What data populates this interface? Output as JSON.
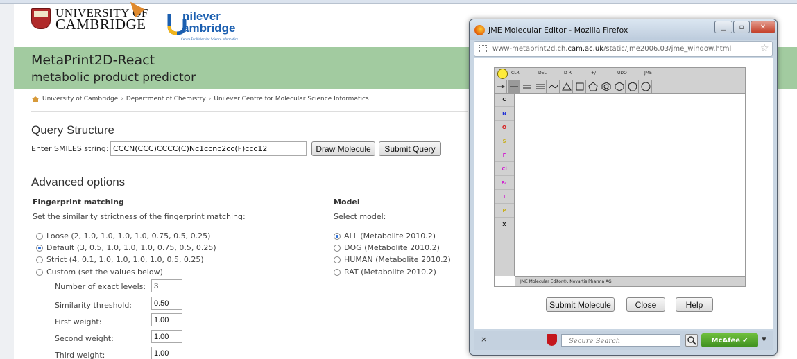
{
  "header": {
    "cambridge_line1": "UNIVERSITY OF",
    "cambridge_line2": "CAMBRIDGE",
    "unilever_line1": "nilever",
    "unilever_line2": "ambridge",
    "unilever_sub": "Centre For Molecular Science Informatics"
  },
  "banner": {
    "title": "MetaPrint2D-React",
    "subtitle": "metabolic product predictor"
  },
  "breadcrumb": [
    "University of Cambridge",
    "Department of Chemistry",
    "Unilever Centre for Molecular Science Informatics"
  ],
  "breadcrumb_sep": "›",
  "query": {
    "heading": "Query Structure",
    "smiles_label": "Enter SMILES string:",
    "smiles_value": "CCCN(CCC)CCCC(C)Nc1ccnc2cc(F)ccc12",
    "draw_button": "Draw Molecule",
    "submit_button": "Submit Query"
  },
  "advanced": {
    "heading": "Advanced options",
    "fingerprint": {
      "heading": "Fingerprint matching",
      "description": "Set the similarity strictness of the fingerprint matching:",
      "options": [
        {
          "label": "Loose (2, 1.0, 1.0, 1.0, 1.0, 0.75, 0.5, 0.25)",
          "checked": false
        },
        {
          "label": "Default (3, 0.5, 1.0, 1.0, 1.0, 0.75, 0.5, 0.25)",
          "checked": true
        },
        {
          "label": "Strict (4, 0.1, 1.0, 1.0, 1.0, 1.0, 0.5, 0.25)",
          "checked": false
        },
        {
          "label": "Custom (set the values below)",
          "checked": false
        }
      ],
      "params": [
        {
          "label": "Number of exact levels:",
          "value": "3"
        },
        {
          "label": "Similarity threshold:",
          "value": "0.50"
        },
        {
          "label": "First weight:",
          "value": "1.00"
        },
        {
          "label": "Second weight:",
          "value": "1.00"
        },
        {
          "label": "Third weight:",
          "value": "1.00"
        }
      ]
    },
    "model": {
      "heading": "Model",
      "description": "Select model:",
      "options": [
        {
          "label": "ALL (Metabolite 2010.2)",
          "checked": true
        },
        {
          "label": "DOG (Metabolite 2010.2)",
          "checked": false
        },
        {
          "label": "HUMAN (Metabolite 2010.2)",
          "checked": false
        },
        {
          "label": "RAT (Metabolite 2010.2)",
          "checked": false
        }
      ]
    }
  },
  "popup": {
    "title": "JME Molecular Editor - Mozilla Firefox",
    "url_prefix": "www-metaprint2d.ch.",
    "url_domain": "cam.ac.uk",
    "url_suffix": "/static/jme2006.03/jme_window.html",
    "jme": {
      "toolbar_labels": [
        "CLR",
        "DEL",
        "D-R",
        "+/-",
        "UDO",
        "JME"
      ],
      "elements": [
        {
          "symbol": "C",
          "color": "#222222"
        },
        {
          "symbol": "N",
          "color": "#1f2fd6"
        },
        {
          "symbol": "O",
          "color": "#d61f1f"
        },
        {
          "symbol": "S",
          "color": "#c9b020"
        },
        {
          "symbol": "F",
          "color": "#d01fd0"
        },
        {
          "symbol": "Cl",
          "color": "#d01fd0"
        },
        {
          "symbol": "Br",
          "color": "#d01fd0"
        },
        {
          "symbol": "I",
          "color": "#d01fd0"
        },
        {
          "symbol": "P",
          "color": "#c9b020"
        },
        {
          "symbol": "X",
          "color": "#222222"
        }
      ],
      "status": "JME Molecular Editor©, Novartis Pharma AG"
    },
    "buttons": {
      "submit": "Submit Molecule",
      "close": "Close",
      "help": "Help"
    },
    "statusbar": {
      "close": "×",
      "search_placeholder": "Secure Search",
      "mcafee": "McAfee"
    }
  }
}
